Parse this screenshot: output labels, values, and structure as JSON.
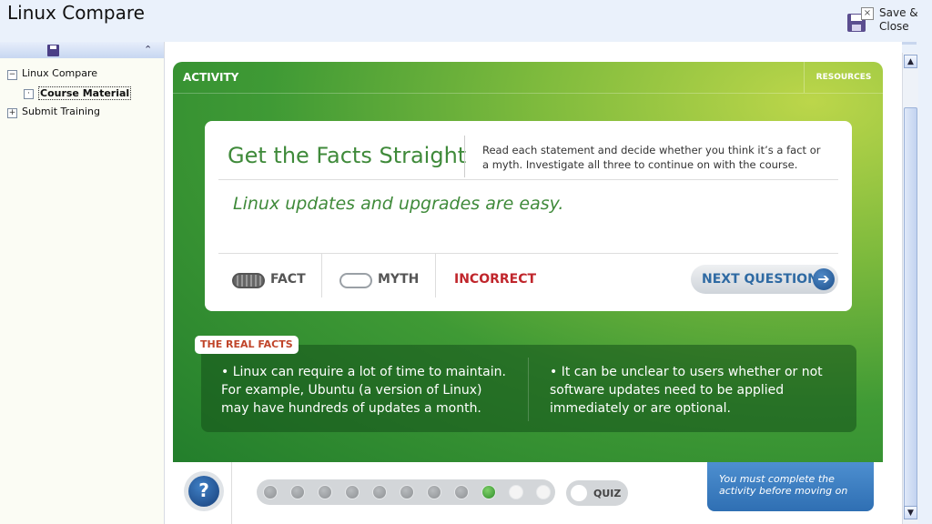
{
  "app": {
    "title": "Linux Compare"
  },
  "header": {
    "save_close_label": "Save & Close"
  },
  "tree": {
    "items": [
      {
        "label": "Linux Compare",
        "toggle": "−"
      },
      {
        "label": "Course Material",
        "toggle": "·"
      },
      {
        "label": "Submit Training",
        "toggle": "+"
      }
    ]
  },
  "activity": {
    "header": "ACTIVITY",
    "resources_label": "RESOURCES",
    "title": "Get the Facts Straight",
    "instructions": "Read each statement and decide whether you think it’s a fact or a myth. Investigate all three to continue on with the course.",
    "statement": "Linux updates and upgrades are easy.",
    "options": {
      "fact": "FACT",
      "myth": "MYTH"
    },
    "result": "INCORRECT",
    "next_question": "NEXT QUESTION",
    "real_facts": {
      "tag": "THE REAL FACTS",
      "items": [
        "• Linux can require a lot of time to maintain. For example, Ubuntu (a version of Linux) may have hundreds of updates a month.",
        "• It can be unclear to users whether or not software updates need to be applied immediately or are optional."
      ]
    }
  },
  "bottom": {
    "help_icon": "?",
    "progress": {
      "total": 11,
      "current": 9
    },
    "quiz_label": "QUIZ",
    "notice": "You must complete the activity before moving on"
  },
  "colors": {
    "green_accent": "#3f8a3a",
    "incorrect_red": "#c0262c",
    "link_blue": "#2f6aa3"
  }
}
